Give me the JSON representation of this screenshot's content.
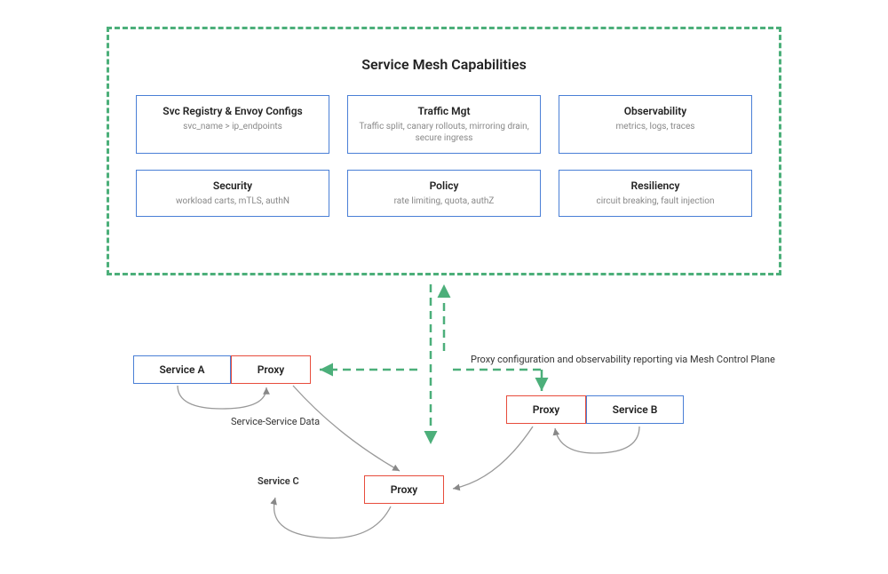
{
  "mesh": {
    "title": "Service Mesh Capabilities",
    "capabilities": [
      {
        "title": "Svc Registry & Envoy Configs",
        "sub": "svc_name >  ip_endpoints"
      },
      {
        "title": "Traffic Mgt",
        "sub": "Traffic split, canary rollouts, mirroring drain, secure ingress"
      },
      {
        "title": "Observability",
        "sub": "metrics, logs, traces"
      },
      {
        "title": "Security",
        "sub": "workload carts, mTLS, authN"
      },
      {
        "title": "Policy",
        "sub": "rate limiting, quota, authZ"
      },
      {
        "title": "Resiliency",
        "sub": "circuit breaking, fault injection"
      }
    ]
  },
  "nodes": {
    "serviceA": "Service A",
    "proxyA": "Proxy",
    "serviceB": "Service B",
    "proxyB": "Proxy",
    "proxyC": "Proxy",
    "serviceC": "Service C"
  },
  "labels": {
    "config": "Proxy configuration and observability reporting via Mesh Control Plane",
    "data": "Service-Service Data"
  },
  "colors": {
    "green": "#4caf7a",
    "blue": "#4a7fd6",
    "red": "#e74c3c",
    "gray": "#666"
  }
}
